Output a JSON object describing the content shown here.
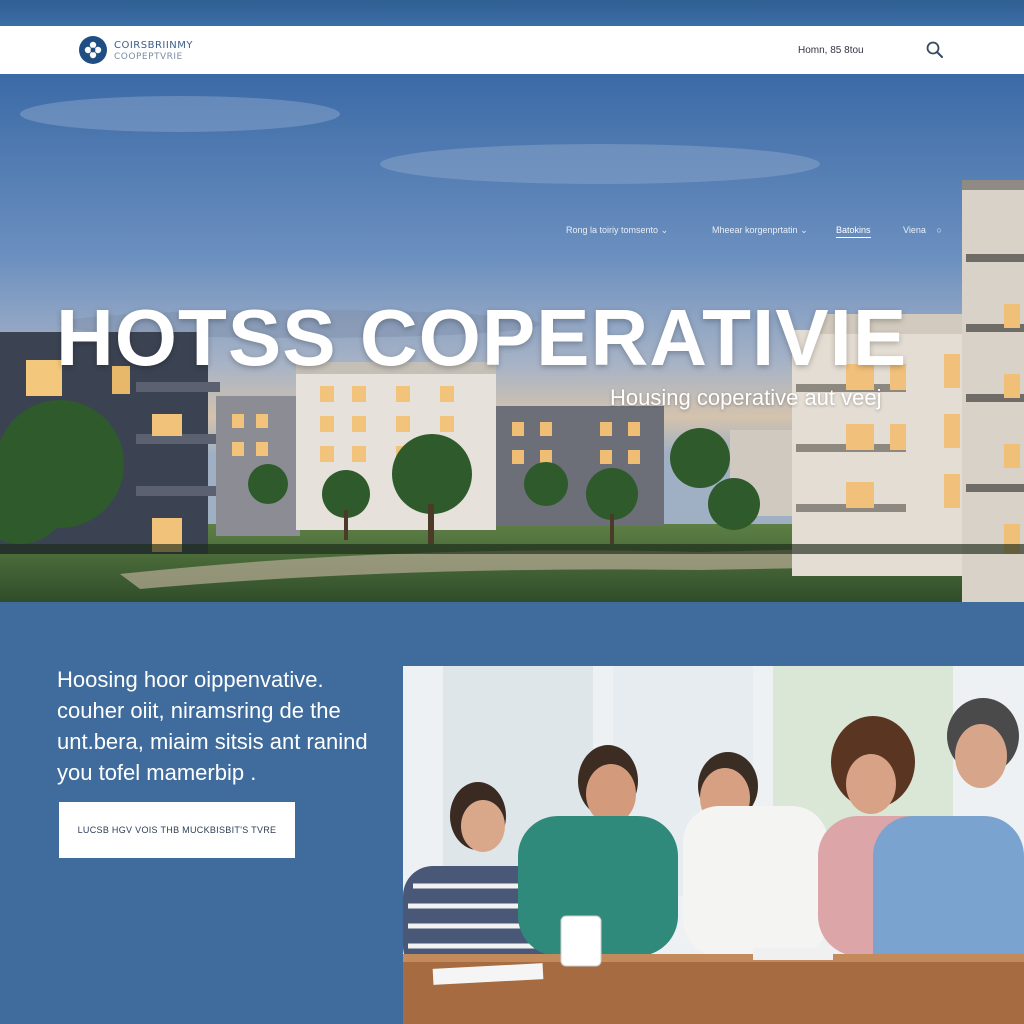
{
  "brand": {
    "name_line1": "COIRSBRIINMY",
    "name_line2": "COOPEPTVRIE"
  },
  "header": {
    "contact_text": "Homn, 85 8tou"
  },
  "icons": {
    "logo": "flower-icon",
    "search": "search-icon",
    "dropdown": "chevron-down-icon",
    "nav_circle": "circle-icon"
  },
  "hero": {
    "nav": [
      {
        "label": "Rong la toiriy tomsento",
        "has_dropdown": true
      },
      {
        "label": "Mheear korgenprtatin",
        "has_dropdown": true
      },
      {
        "label": "Batokins",
        "active": true
      },
      {
        "label": "Viena"
      }
    ],
    "title": "HOTSS COPERATIVIE",
    "subtitle": "Housing coperative aut veej"
  },
  "intro": {
    "lines": [
      "Hoosing hoor oippenvative.",
      "couher oiit, niramsring de the",
      "unt.bera, miaim sitsis ant ranind",
      "you tofel mamerbip ."
    ]
  },
  "cta": {
    "label": "LUCSB HGV VOIS THB MUCKBISBIT'S TVRE"
  },
  "colors": {
    "brand_blue": "#1f4f82",
    "section_blue": "#3f6c9c",
    "white": "#ffffff"
  }
}
